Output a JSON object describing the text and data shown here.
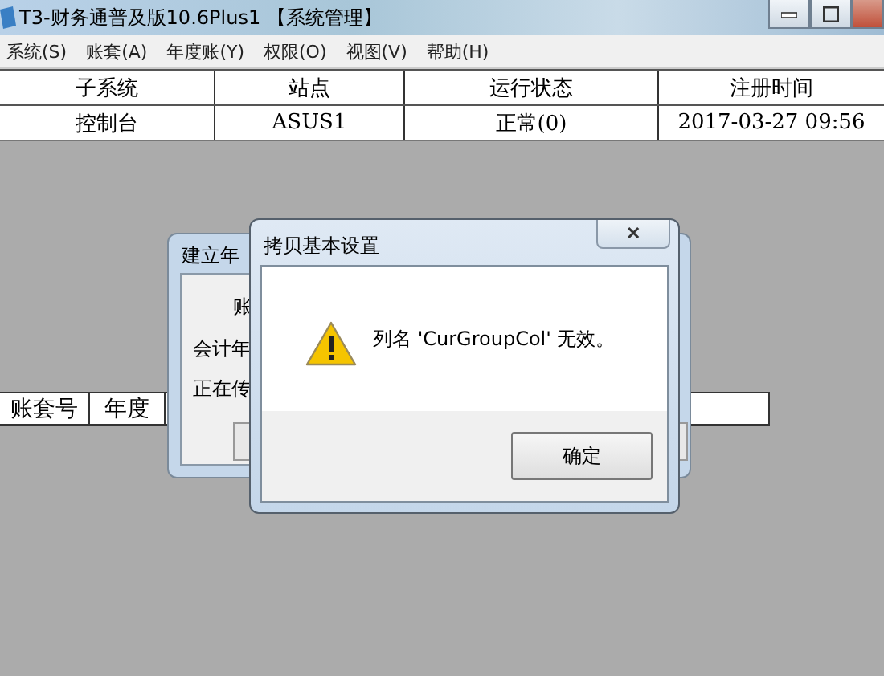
{
  "window": {
    "title": "T3-财务通普及版10.6Plus1 【系统管理】"
  },
  "menu": [
    "系统(S)",
    "账套(A)",
    "年度账(Y)",
    "权限(O)",
    "视图(V)",
    "帮助(H)"
  ],
  "table": {
    "columns": [
      "子系统",
      "站点",
      "运行状态",
      "注册时间"
    ],
    "rows": [
      [
        "控制台",
        "ASUS1",
        "正常(0)",
        "2017-03-27 09:56"
      ]
    ]
  },
  "lower_table": {
    "columns": [
      "账套号",
      "年度"
    ]
  },
  "back_dialog": {
    "title": "建立年",
    "labels": [
      "账",
      "会计年",
      "正在传"
    ]
  },
  "message_dialog": {
    "title": "拷贝基本设置",
    "close": "✕",
    "message": "列名 'CurGroupCol' 无效。",
    "buttons": [
      "确定"
    ]
  }
}
